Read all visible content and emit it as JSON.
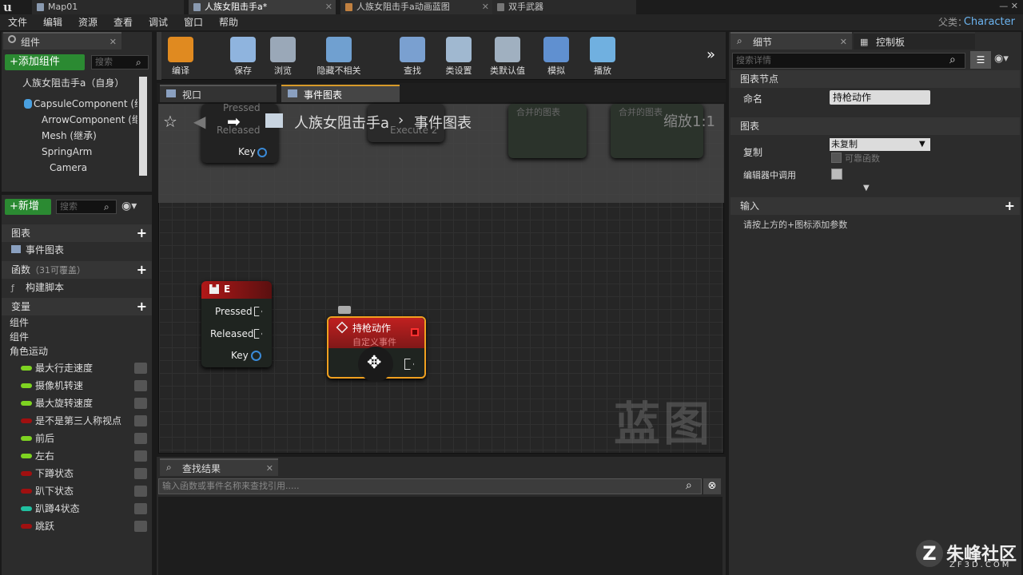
{
  "window": {
    "logo": "u",
    "tabs": [
      {
        "label": "Map01"
      },
      {
        "label": "人族女阻击手a*"
      },
      {
        "label": "人族女阻击手a动画蓝图"
      },
      {
        "label": "双手武器"
      }
    ],
    "parent_label": "父类：",
    "parent_value": "Character"
  },
  "menu": [
    "文件",
    "编辑",
    "资源",
    "查看",
    "调试",
    "窗口",
    "帮助"
  ],
  "components": {
    "tab_label": "组件",
    "add_button": "+添加组件",
    "search_placeholder": "搜索",
    "tree": [
      "人族女阻击手a（自身）",
      "CapsuleComponent (继承)",
      "ArrowComponent (继承)",
      "Mesh (继承)",
      "SpringArm",
      "Camera"
    ]
  },
  "mybp": {
    "new_button": "+新增",
    "search_placeholder": "搜索",
    "graphs_header": "图表",
    "event_graph": "事件图表",
    "functions_header": "函数",
    "functions_count": "（31可覆盖）",
    "construction": "构建脚本",
    "variables_header": "变量",
    "groups": [
      "组件",
      "组件",
      "角色运动"
    ],
    "variables": [
      {
        "name": "最大行走速度",
        "color": "#7ed321"
      },
      {
        "name": "摄像机转速",
        "color": "#7ed321"
      },
      {
        "name": "最大旋转速度",
        "color": "#7ed321"
      },
      {
        "name": "是不是第三人称视点",
        "color": "#a01010"
      },
      {
        "name": "前后",
        "color": "#7ed321"
      },
      {
        "name": "左右",
        "color": "#7ed321"
      },
      {
        "name": "下蹲状态",
        "color": "#a01010"
      },
      {
        "name": "趴下状态",
        "color": "#a01010"
      },
      {
        "name": "趴蹲4状态",
        "color": "#20c0a0"
      },
      {
        "name": "跳跃",
        "color": "#a01010"
      }
    ]
  },
  "toolbar": [
    {
      "label": "编译",
      "icon": "compile-icon"
    },
    {
      "label": "保存",
      "icon": "save-icon"
    },
    {
      "label": "浏览",
      "icon": "browse-icon"
    },
    {
      "label": "隐藏不相关",
      "icon": "hide-unrelated-icon"
    },
    {
      "label": "查找",
      "icon": "find-icon"
    },
    {
      "label": "类设置",
      "icon": "class-settings-icon"
    },
    {
      "label": "类默认值",
      "icon": "class-defaults-icon"
    },
    {
      "label": "模拟",
      "icon": "simulate-icon"
    },
    {
      "label": "播放",
      "icon": "play-icon"
    }
  ],
  "editor_tabs": {
    "viewport": "视口",
    "event_graph": "事件图表"
  },
  "graph": {
    "breadcrumb_asset": "人族女阻击手a",
    "breadcrumb_graph": "事件图表",
    "zoom": "缩放1:1",
    "watermark": "蓝图",
    "ghost_pressed": "Pressed",
    "ghost_released": "Released",
    "ghost_key": "Key",
    "ghost_execute": "Execute 2",
    "ghost_merged_1": "合并的图表",
    "ghost_merged_2": "合并的图表",
    "node_e": {
      "title": "E",
      "pressed": "Pressed",
      "released": "Released",
      "key": "Key"
    },
    "node_custom": {
      "title": "持枪动作",
      "subtitle": "自定义事件"
    }
  },
  "find": {
    "tab_label": "查找结果",
    "placeholder": "输入函数或事件名称来查找引用....."
  },
  "details": {
    "tab_label": "细节",
    "tab_label_2": "控制板",
    "search_placeholder": "搜索详情",
    "graph_node_section": "图表节点",
    "name_label": "命名",
    "name_value": "持枪动作",
    "graph_section": "图表",
    "replicate_label": "复制",
    "replicate_value": "未复制",
    "reliable_label": "可靠函数",
    "call_in_editor_label": "编辑器中调用",
    "inputs_section": "输入",
    "inputs_hint": "请按上方的+图标添加参数"
  },
  "branding": {
    "name": "朱峰社区",
    "url": "ZF3D.COM",
    "logo_letter": "Z"
  }
}
